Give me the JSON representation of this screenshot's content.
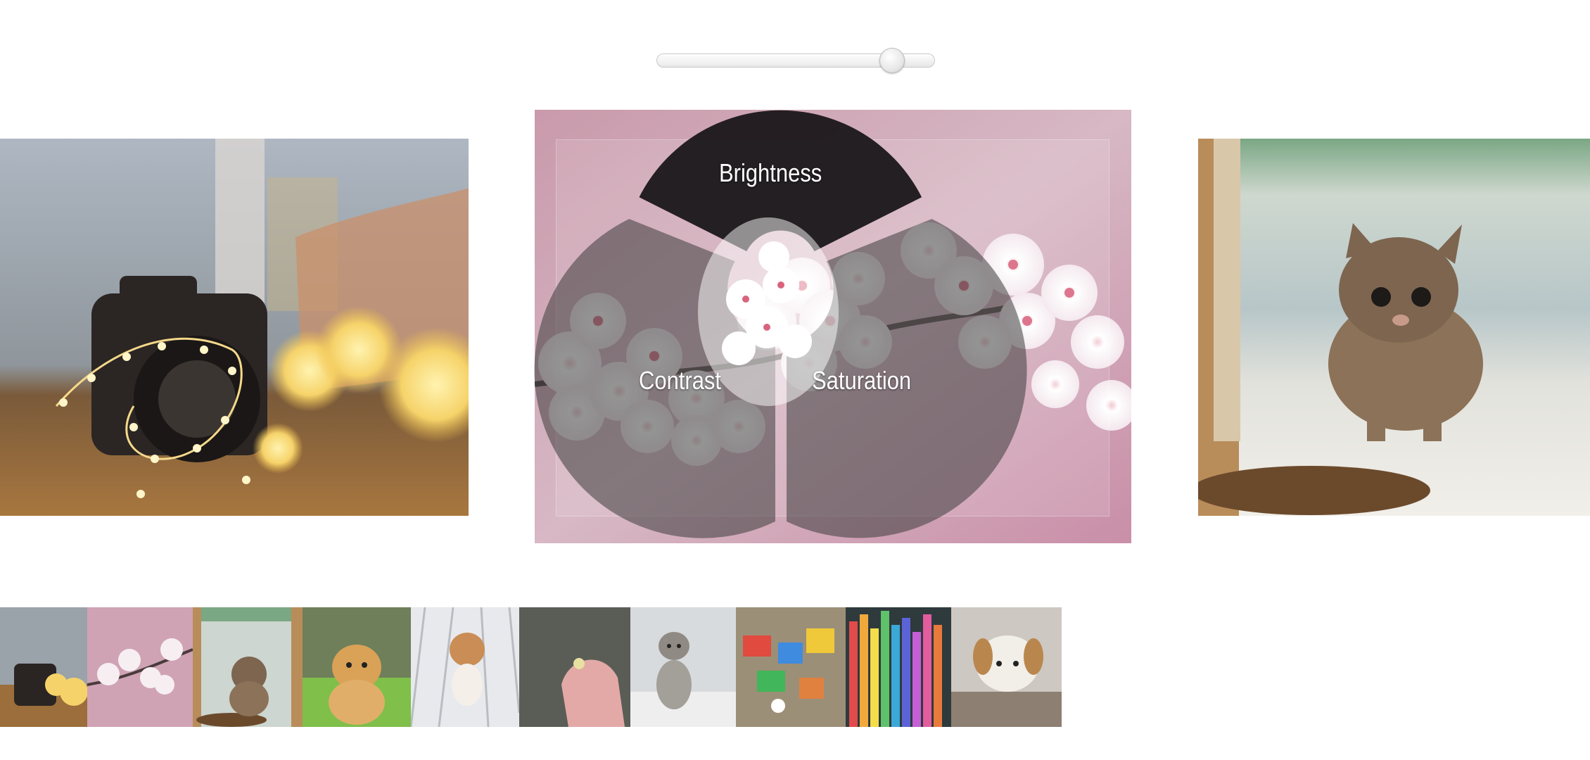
{
  "slider": {
    "value_fraction": 0.88
  },
  "radial_menu": {
    "brightness_label": "Brightness",
    "contrast_label": "Contrast",
    "saturation_label": "Saturation"
  },
  "images": {
    "previous": "camera-with-fairy-lights",
    "current": "cherry-blossom-branch",
    "next": "kitten-on-cat-tree"
  },
  "thumbnails": [
    "camera-with-fairy-lights",
    "cherry-blossom-branch",
    "kitten-on-cat-tree",
    "golden-puppy-on-grass",
    "puppy-on-white-deck",
    "hand-holding-object",
    "tabby-kitten-standing",
    "colorful-toys",
    "colored-pencils",
    "puppy-on-rug"
  ],
  "colors": {
    "menu_active": "#1e1a1d",
    "menu_inactive": "rgba(60,60,60,0.55)",
    "menu_label": "#ffffff"
  }
}
